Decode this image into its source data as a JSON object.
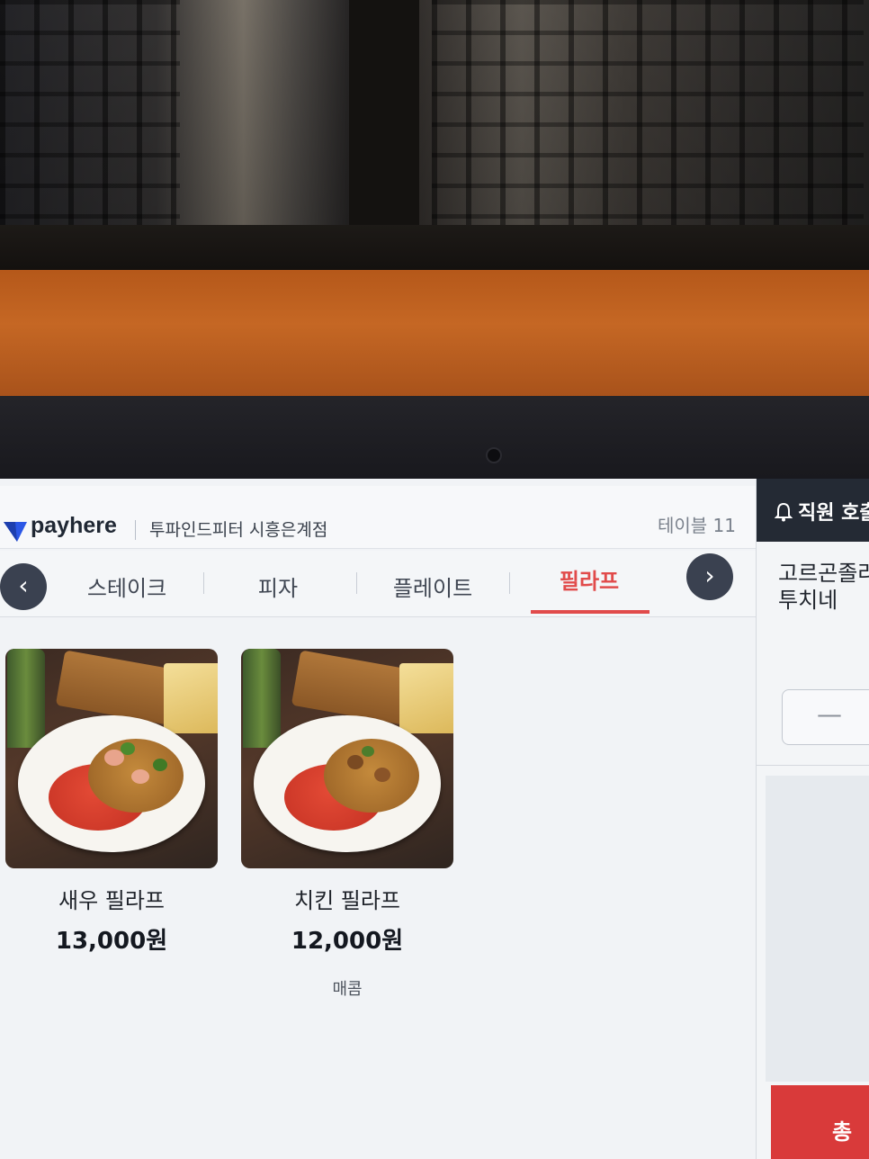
{
  "brand": {
    "name": "payhere"
  },
  "header": {
    "store_name": "투파인드피터 시흥은계점",
    "table_label": "테이블 11"
  },
  "tabs": {
    "prev_icon": "chevron-left-icon",
    "next_icon": "chevron-right-icon",
    "items": [
      {
        "label": "스테이크",
        "active": false
      },
      {
        "label": "피자",
        "active": false
      },
      {
        "label": "플레이트",
        "active": false
      },
      {
        "label": "필라프",
        "active": true
      }
    ]
  },
  "products": [
    {
      "name": "새우 필라프",
      "price": "13,000원",
      "tag": ""
    },
    {
      "name": "치킨 필라프",
      "price": "12,000원",
      "tag": "매콤"
    }
  ],
  "side": {
    "staff_call_label": "직원 호출",
    "title": "고르곤졸라\n투치네",
    "qty_minus": "—",
    "total_label": "총"
  },
  "colors": {
    "accent": "#e14b4b",
    "dark": "#242a34",
    "total_bar": "#d93a3a"
  }
}
